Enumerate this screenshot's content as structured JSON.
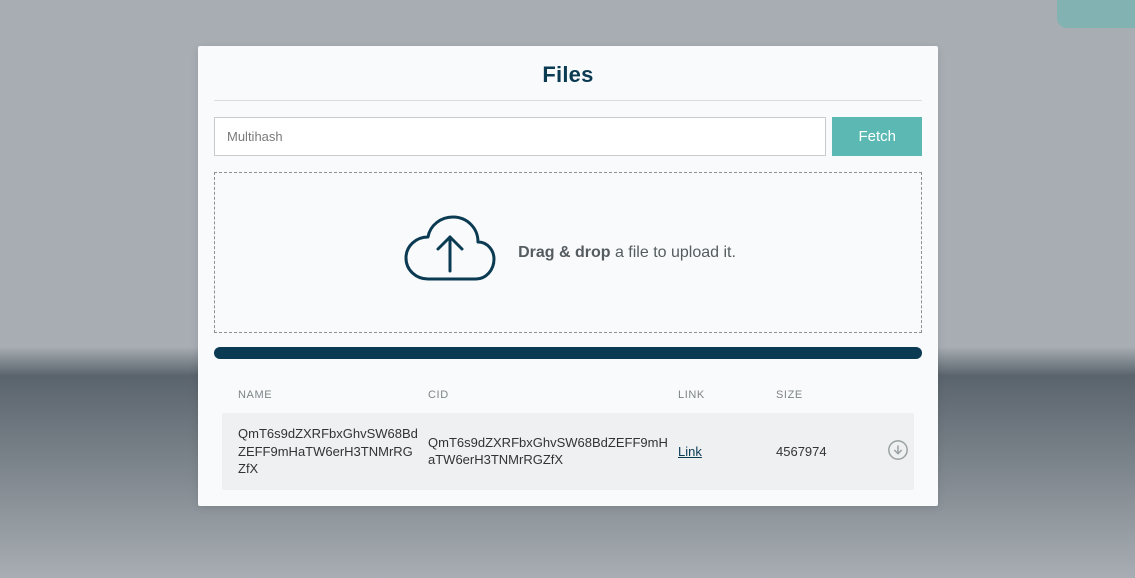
{
  "header": {
    "title": "Files"
  },
  "fetch": {
    "placeholder": "Multihash",
    "value": "",
    "button_label": "Fetch"
  },
  "dropzone": {
    "bold": "Drag & drop",
    "rest": " a file to upload it."
  },
  "table": {
    "headers": {
      "name": "NAME",
      "cid": "CID",
      "link": "LINK",
      "size": "SIZE"
    },
    "rows": [
      {
        "name": "QmT6s9dZXRFbxGhvSW68BdZEFF9mHaTW6erH3TNMrRGZfX",
        "cid": "QmT6s9dZXRFbxGhvSW68BdZEFF9mHaTW6erH3TNMrRGZfX",
        "link_label": "Link",
        "size": "4567974"
      }
    ]
  }
}
